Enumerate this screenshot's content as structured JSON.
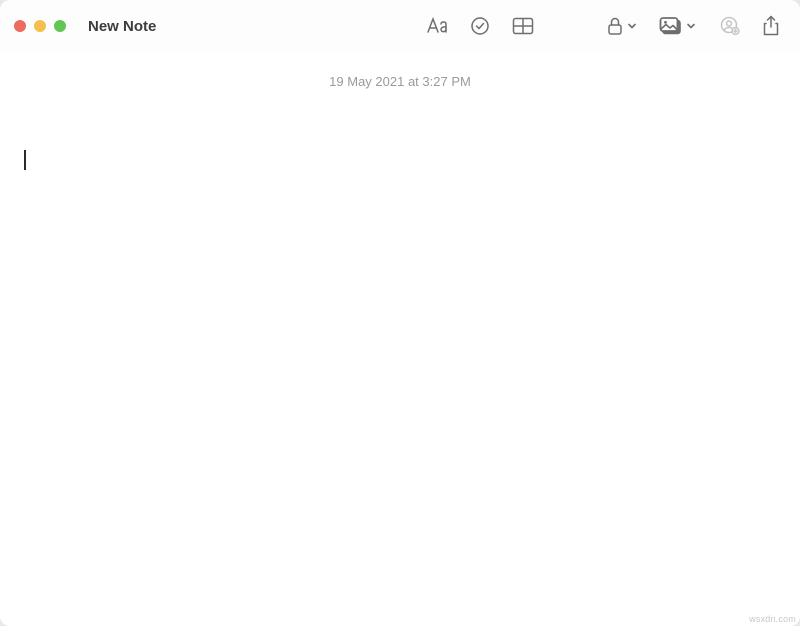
{
  "window": {
    "title": "New Note"
  },
  "toolbar": {
    "icons": {
      "format": "format-icon",
      "checklist": "checklist-icon",
      "table": "table-icon",
      "lock": "lock-icon",
      "media": "media-icon",
      "collaborate": "collaborate-icon",
      "share": "share-icon"
    }
  },
  "note": {
    "timestamp": "19 May 2021 at 3:27 PM",
    "body": ""
  },
  "watermark": "wsxdn.com"
}
